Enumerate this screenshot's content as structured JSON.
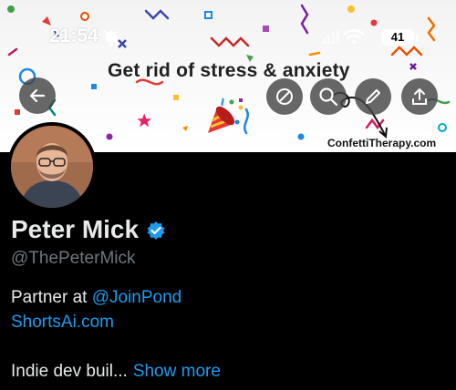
{
  "status_bar": {
    "time": "21:54",
    "battery": "41"
  },
  "banner": {
    "title": "Get rid of stress & anxiety",
    "url_text": "ConfettiTherapy.com"
  },
  "header_buttons": {
    "back": "back-arrow-icon",
    "circle": "circle-slash-icon",
    "search": "search-icon",
    "edit": "pencil-icon",
    "share": "share-icon"
  },
  "profile": {
    "name": "Peter Mick",
    "handle": "@ThePeterMick",
    "bio_prefix": "Partner at ",
    "bio_mention": "@JoinPond",
    "bio_link": "ShortsAi.com",
    "bio_truncated": "Indie dev buil...",
    "show_more": "Show more"
  },
  "colors": {
    "link": "#1d9bf0",
    "verified": "#1d9bf0",
    "text": "#e7e9ea",
    "muted": "#71767b"
  }
}
